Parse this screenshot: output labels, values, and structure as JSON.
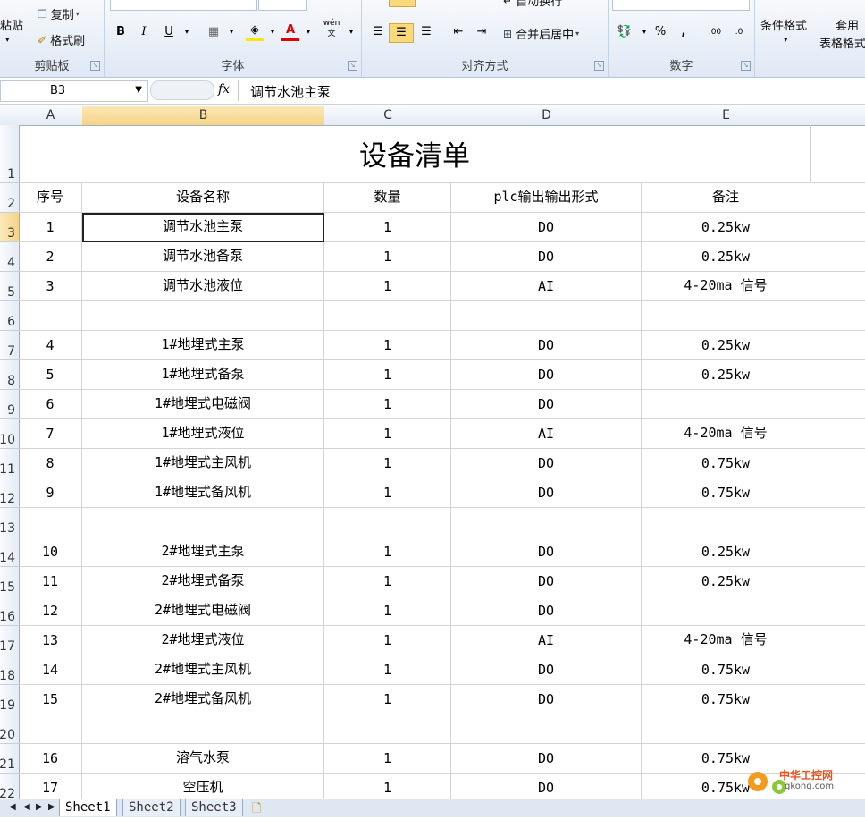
{
  "ribbon": {
    "clipboard": {
      "paste": "粘贴",
      "copy": "复制",
      "format_painter": "格式刷",
      "label": "剪贴板"
    },
    "font": {
      "bold": "B",
      "italic": "I",
      "underline": "U",
      "font_color_glyph": "A",
      "phonetic": "wén",
      "label": "字体"
    },
    "alignment": {
      "merge_center": "合并后居中",
      "wrap": "自动换行",
      "label": "对齐方式"
    },
    "number": {
      "percent": "%",
      "comma": ",",
      "increase_decimal": ".00",
      "decrease_decimal": ".0",
      "label": "数字"
    },
    "styles": {
      "conditional": "条件格式",
      "table_format_1": "套用",
      "table_format_2": "表格格式"
    }
  },
  "formula_bar": {
    "name_box": "B3",
    "fx": "fx",
    "value": "调节水池主泵"
  },
  "columns": [
    "A",
    "B",
    "C",
    "D",
    "E"
  ],
  "rows": [
    {
      "n": "1",
      "cells": [
        "设备清单"
      ],
      "title": true
    },
    {
      "n": "2",
      "cells": [
        "序号",
        "设备名称",
        "数量",
        "plc输出输出形式",
        "备注"
      ]
    },
    {
      "n": "3",
      "cells": [
        "1",
        "调节水池主泵",
        "1",
        "DO",
        "0.25kw"
      ]
    },
    {
      "n": "4",
      "cells": [
        "2",
        "调节水池备泵",
        "1",
        "DO",
        "0.25kw"
      ]
    },
    {
      "n": "5",
      "cells": [
        "3",
        "调节水池液位",
        "1",
        "AI",
        "4-20ma 信号"
      ]
    },
    {
      "n": "6",
      "cells": [
        "",
        "",
        "",
        "",
        ""
      ]
    },
    {
      "n": "7",
      "cells": [
        "4",
        "1#地埋式主泵",
        "1",
        "DO",
        "0.25kw"
      ]
    },
    {
      "n": "8",
      "cells": [
        "5",
        "1#地埋式备泵",
        "1",
        "DO",
        "0.25kw"
      ]
    },
    {
      "n": "9",
      "cells": [
        "6",
        "1#地埋式电磁阀",
        "1",
        "DO",
        ""
      ]
    },
    {
      "n": "10",
      "cells": [
        "7",
        "1#地埋式液位",
        "1",
        "AI",
        "4-20ma 信号"
      ]
    },
    {
      "n": "11",
      "cells": [
        "8",
        "1#地埋式主风机",
        "1",
        "DO",
        "0.75kw"
      ]
    },
    {
      "n": "12",
      "cells": [
        "9",
        "1#地埋式备风机",
        "1",
        "DO",
        "0.75kw"
      ]
    },
    {
      "n": "13",
      "cells": [
        "",
        "",
        "",
        "",
        ""
      ]
    },
    {
      "n": "14",
      "cells": [
        "10",
        "2#地埋式主泵",
        "1",
        "DO",
        "0.25kw"
      ]
    },
    {
      "n": "15",
      "cells": [
        "11",
        "2#地埋式备泵",
        "1",
        "DO",
        "0.25kw"
      ]
    },
    {
      "n": "16",
      "cells": [
        "12",
        "2#地埋式电磁阀",
        "1",
        "DO",
        ""
      ]
    },
    {
      "n": "17",
      "cells": [
        "13",
        "2#地埋式液位",
        "1",
        "AI",
        "4-20ma 信号"
      ]
    },
    {
      "n": "18",
      "cells": [
        "14",
        "2#地埋式主风机",
        "1",
        "DO",
        "0.75kw"
      ]
    },
    {
      "n": "19",
      "cells": [
        "15",
        "2#地埋式备风机",
        "1",
        "DO",
        "0.75kw"
      ]
    },
    {
      "n": "20",
      "cells": [
        "",
        "",
        "",
        "",
        ""
      ]
    },
    {
      "n": "21",
      "cells": [
        "16",
        "溶气水泵",
        "1",
        "DO",
        "0.75kw"
      ]
    },
    {
      "n": "22",
      "cells": [
        "17",
        "空压机",
        "1",
        "DO",
        "0.75kw"
      ]
    }
  ],
  "sheets": [
    "Sheet1",
    "Sheet2",
    "Sheet3"
  ],
  "watermark": {
    "name": "中华工控网",
    "url": "gkong.com"
  },
  "colors": {
    "accent": "#f6d386",
    "font_color": "#e00000",
    "fill_color": "#ffe600"
  }
}
